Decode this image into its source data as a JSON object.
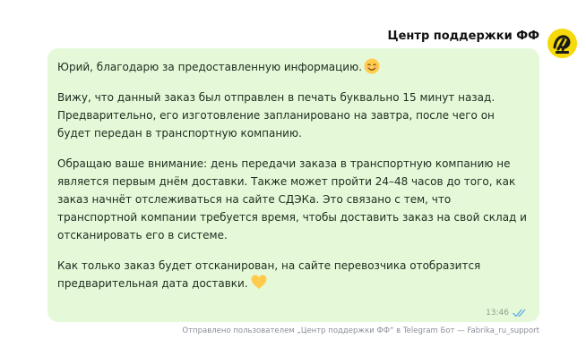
{
  "header": {
    "sender_name": "Центр поддержки ФФ"
  },
  "avatar": {
    "icon": "fabrika-logo-icon",
    "background_color": "#f5d90a"
  },
  "message": {
    "greeting": "Юрий, благодарю за предоставленную информацию.",
    "paragraph_2": "Вижу, что данный заказ был отправлен в печать буквально 15 минут назад. Предварительно, его изготовление запланировано на завтра, после чего он будет передан в транспортную компанию.",
    "paragraph_3": "Обращаю ваше внимание: день передачи заказа в транспортную компанию не является первым днём доставки. Также может пройти 24–48 часов до того, как заказ начнёт отслеживаться на сайте СДЭКа. Это связано с тем, что транспортной компании требуется время, чтобы доставить заказ на свой склад и отсканировать его в системе.",
    "paragraph_4": "Как только заказ будет отсканирован, на сайте перевозчика отобразится предварительная дата доставки.",
    "emoji_1": "smiling-face-icon",
    "emoji_2": "yellow-heart-icon",
    "time": "13:46",
    "status_icon": "double-check-icon",
    "bubble_color": "#e5f9d8"
  },
  "footer": {
    "text": "Отправлено пользователем „Центр поддержки ФФ“ в Telegram Бот — Fabrika_ru_support"
  }
}
